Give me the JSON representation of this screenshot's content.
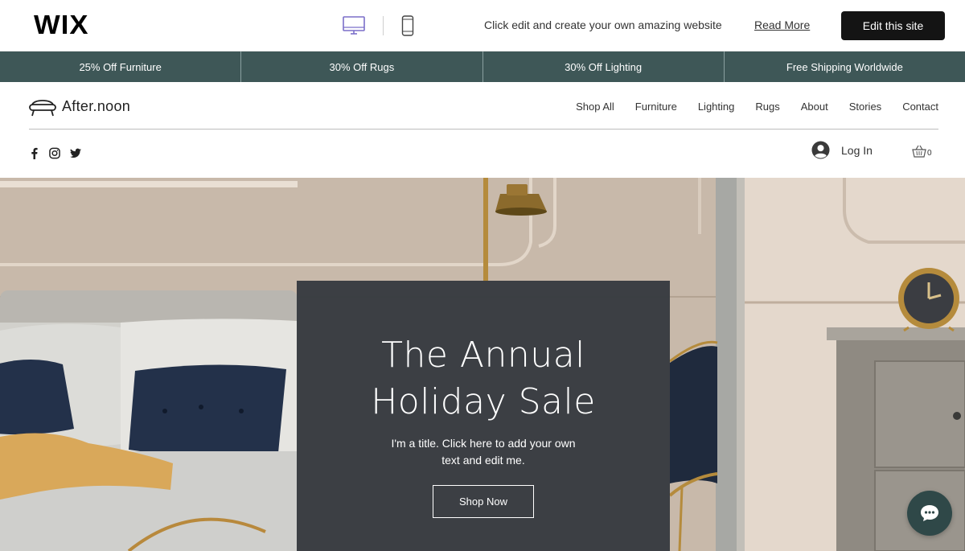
{
  "wix_bar": {
    "logo": "WIX",
    "promo_text": "Click edit and create your own amazing website",
    "read_more": "Read More",
    "edit_button": "Edit this site",
    "devices": [
      {
        "icon": "desktop-icon",
        "active": true
      },
      {
        "icon": "mobile-icon",
        "active": false
      }
    ]
  },
  "promo_strip": {
    "items": [
      "25% Off Furniture",
      "30% Off Rugs",
      "30% Off Lighting",
      "Free Shipping Worldwide"
    ]
  },
  "header": {
    "logo_text": "After.noon",
    "logo_icon": "sofa-icon",
    "nav": [
      "Shop All",
      "Furniture",
      "Lighting",
      "Rugs",
      "About",
      "Stories",
      "Contact"
    ],
    "social": [
      "facebook-icon",
      "instagram-icon",
      "twitter-icon"
    ],
    "login_label": "Log In",
    "cart_count": "0"
  },
  "hero": {
    "title_line1": "The Annual",
    "title_line2": "Holiday Sale",
    "subtitle": "I'm a title. Click here to add your own text and edit me.",
    "button": "Shop Now"
  },
  "colors": {
    "promo_strip_bg": "#3e5757",
    "edit_button_bg": "#141414",
    "hero_card_bg": "#363a40",
    "chat_button_bg": "#2f4848",
    "active_device": "#7b6fc9"
  }
}
